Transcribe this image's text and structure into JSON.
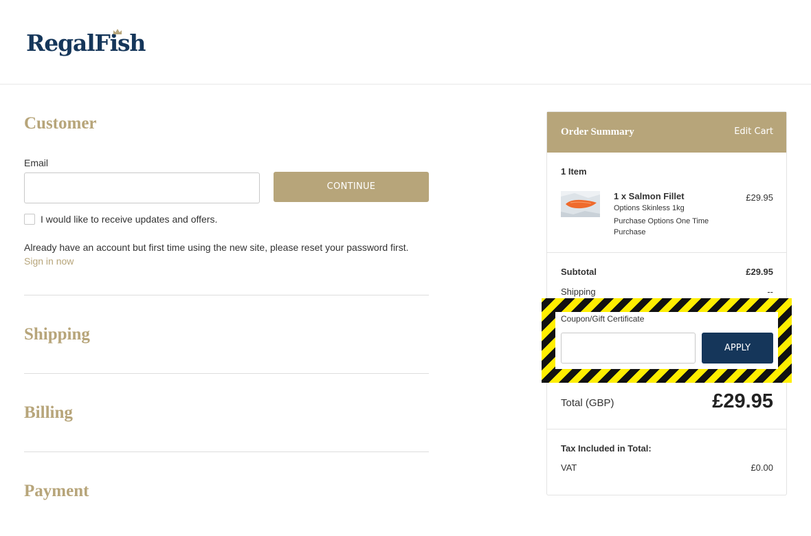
{
  "brand": {
    "logo_text": "RegalFish",
    "primary_color": "#15365a",
    "accent_color": "#b7a57a"
  },
  "customer": {
    "title": "Customer",
    "email_label": "Email",
    "email_value": "",
    "email_placeholder": "",
    "continue_label": "CONTINUE",
    "updates_label": "I would like to receive updates and offers.",
    "updates_checked": false,
    "account_text": "Already have an account but first time using the new site, please reset your password first.",
    "sign_in_link": "Sign in now"
  },
  "sections": {
    "shipping": "Shipping",
    "billing": "Billing",
    "payment": "Payment"
  },
  "summary": {
    "title": "Order Summary",
    "edit_cart": "Edit Cart",
    "item_count": "1 Item",
    "item": {
      "name": "1 x Salmon Fillet",
      "option_1": "Options Skinless 1kg",
      "option_2": "Purchase Options One Time Purchase",
      "price": "£29.95",
      "thumbnail_icon": "salmon-fillet-image"
    },
    "subtotal_label": "Subtotal",
    "subtotal_value": "£29.95",
    "shipping_label": "Shipping",
    "shipping_value": "--",
    "coupon_label": "Coupon/Gift Certificate",
    "coupon_value": "",
    "apply_label": "APPLY",
    "total_label": "Total (GBP)",
    "total_value": "£29.95",
    "tax_heading": "Tax Included in Total:",
    "vat_label": "VAT",
    "vat_value": "£0.00"
  },
  "highlight": {
    "style": "hazard-stripes",
    "colors": [
      "#ffee00",
      "#111111"
    ]
  }
}
